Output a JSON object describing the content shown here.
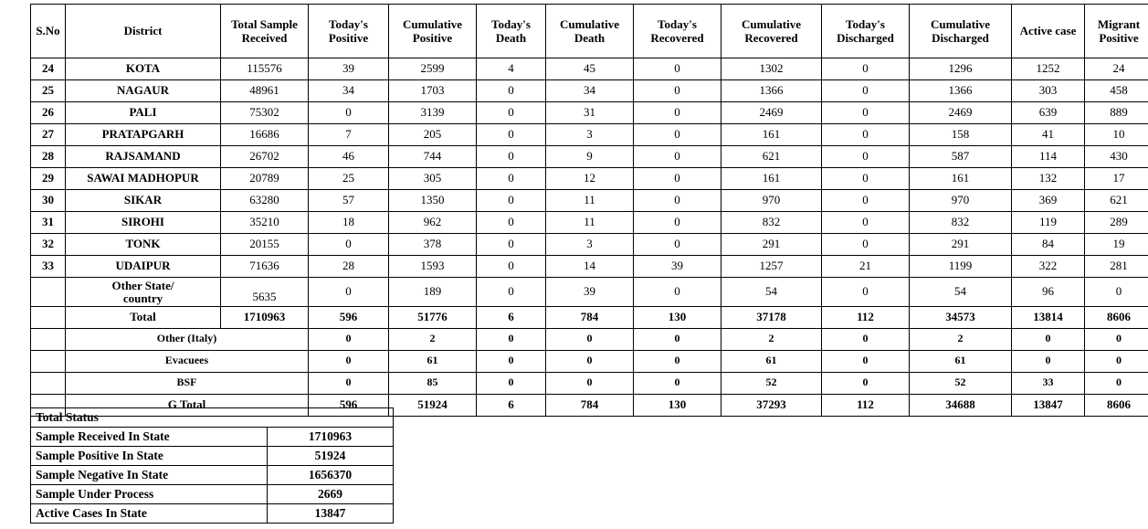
{
  "main_table": {
    "headers": [
      "S.No",
      "District",
      "Total Sample Received",
      "Today's Positive",
      "Cumulative Positive",
      "Today's Death",
      "Cumulative Death",
      "Today's Recovered",
      "Cumulative Recovered",
      "Today's Discharged",
      "Cumulative Discharged",
      "Active case",
      "Migrant Positive"
    ],
    "headers_lines": [
      [
        "S.No"
      ],
      [
        "District"
      ],
      [
        "Total Sample",
        "Received"
      ],
      [
        "Today's",
        "Positive"
      ],
      [
        "Cumulative",
        "Positive"
      ],
      [
        "Today's",
        "Death"
      ],
      [
        "Cumulative",
        "Death"
      ],
      [
        "Today's",
        "Recovered"
      ],
      [
        "Cumulative",
        "Recovered"
      ],
      [
        "Today's",
        "Discharged"
      ],
      [
        "Cumulative",
        "Discharged"
      ],
      [
        "Active  case"
      ],
      [
        "Migrant",
        "Positive"
      ]
    ],
    "rows": [
      {
        "sno": "24",
        "district": "KOTA",
        "total_sample_received": "115576",
        "todays_positive": "39",
        "cumulative_positive": "2599",
        "todays_death": "4",
        "cumulative_death": "45",
        "todays_recovered": "0",
        "cumulative_recovered": "1302",
        "todays_discharged": "0",
        "cumulative_discharged": "1296",
        "active_case": "1252",
        "migrant_positive": "24"
      },
      {
        "sno": "25",
        "district": "NAGAUR",
        "total_sample_received": "48961",
        "todays_positive": "34",
        "cumulative_positive": "1703",
        "todays_death": "0",
        "cumulative_death": "34",
        "todays_recovered": "0",
        "cumulative_recovered": "1366",
        "todays_discharged": "0",
        "cumulative_discharged": "1366",
        "active_case": "303",
        "migrant_positive": "458"
      },
      {
        "sno": "26",
        "district": "PALI",
        "total_sample_received": "75302",
        "todays_positive": "0",
        "cumulative_positive": "3139",
        "todays_death": "0",
        "cumulative_death": "31",
        "todays_recovered": "0",
        "cumulative_recovered": "2469",
        "todays_discharged": "0",
        "cumulative_discharged": "2469",
        "active_case": "639",
        "migrant_positive": "889"
      },
      {
        "sno": "27",
        "district": "PRATAPGARH",
        "total_sample_received": "16686",
        "todays_positive": "7",
        "cumulative_positive": "205",
        "todays_death": "0",
        "cumulative_death": "3",
        "todays_recovered": "0",
        "cumulative_recovered": "161",
        "todays_discharged": "0",
        "cumulative_discharged": "158",
        "active_case": "41",
        "migrant_positive": "10"
      },
      {
        "sno": "28",
        "district": "RAJSAMAND",
        "total_sample_received": "26702",
        "todays_positive": "46",
        "cumulative_positive": "744",
        "todays_death": "0",
        "cumulative_death": "9",
        "todays_recovered": "0",
        "cumulative_recovered": "621",
        "todays_discharged": "0",
        "cumulative_discharged": "587",
        "active_case": "114",
        "migrant_positive": "430"
      },
      {
        "sno": "29",
        "district": "SAWAI MADHOPUR",
        "total_sample_received": "20789",
        "todays_positive": "25",
        "cumulative_positive": "305",
        "todays_death": "0",
        "cumulative_death": "12",
        "todays_recovered": "0",
        "cumulative_recovered": "161",
        "todays_discharged": "0",
        "cumulative_discharged": "161",
        "active_case": "132",
        "migrant_positive": "17"
      },
      {
        "sno": "30",
        "district": "SIKAR",
        "total_sample_received": "63280",
        "todays_positive": "57",
        "cumulative_positive": "1350",
        "todays_death": "0",
        "cumulative_death": "11",
        "todays_recovered": "0",
        "cumulative_recovered": "970",
        "todays_discharged": "0",
        "cumulative_discharged": "970",
        "active_case": "369",
        "migrant_positive": "621"
      },
      {
        "sno": "31",
        "district": "SIROHI",
        "total_sample_received": "35210",
        "todays_positive": "18",
        "cumulative_positive": "962",
        "todays_death": "0",
        "cumulative_death": "11",
        "todays_recovered": "0",
        "cumulative_recovered": "832",
        "todays_discharged": "0",
        "cumulative_discharged": "832",
        "active_case": "119",
        "migrant_positive": "289"
      },
      {
        "sno": "32",
        "district": "TONK",
        "total_sample_received": "20155",
        "todays_positive": "0",
        "cumulative_positive": "378",
        "todays_death": "0",
        "cumulative_death": "3",
        "todays_recovered": "0",
        "cumulative_recovered": "291",
        "todays_discharged": "0",
        "cumulative_discharged": "291",
        "active_case": "84",
        "migrant_positive": "19"
      },
      {
        "sno": "33",
        "district": "UDAIPUR",
        "total_sample_received": "71636",
        "todays_positive": "28",
        "cumulative_positive": "1593",
        "todays_death": "0",
        "cumulative_death": "14",
        "todays_recovered": "39",
        "cumulative_recovered": "1257",
        "todays_discharged": "21",
        "cumulative_discharged": "1199",
        "active_case": "322",
        "migrant_positive": "281"
      }
    ],
    "other_state_row": {
      "sno": "",
      "district_line1": "Other State/",
      "district_line2": "country",
      "total_sample_received": "5635",
      "todays_positive": "0",
      "cumulative_positive": "189",
      "todays_death": "0",
      "cumulative_death": "39",
      "todays_recovered": "0",
      "cumulative_recovered": "54",
      "todays_discharged": "0",
      "cumulative_discharged": "54",
      "active_case": "96",
      "migrant_positive": "0"
    },
    "total_row": {
      "label": "Total",
      "total_sample_received": "1710963",
      "todays_positive": "596",
      "cumulative_positive": "51776",
      "todays_death": "6",
      "cumulative_death": "784",
      "todays_recovered": "130",
      "cumulative_recovered": "37178",
      "todays_discharged": "112",
      "cumulative_discharged": "34573",
      "active_case": "13814",
      "migrant_positive": "8606"
    },
    "sub_rows": [
      {
        "label": "Other (Italy)",
        "todays_positive": "0",
        "cumulative_positive": "2",
        "todays_death": "0",
        "cumulative_death": "0",
        "todays_recovered": "0",
        "cumulative_recovered": "2",
        "todays_discharged": "0",
        "cumulative_discharged": "2",
        "active_case": "0",
        "migrant_positive": "0"
      },
      {
        "label": "Evacuees",
        "todays_positive": "0",
        "cumulative_positive": "61",
        "todays_death": "0",
        "cumulative_death": "0",
        "todays_recovered": "0",
        "cumulative_recovered": "61",
        "todays_discharged": "0",
        "cumulative_discharged": "61",
        "active_case": "0",
        "migrant_positive": "0"
      },
      {
        "label": "BSF",
        "todays_positive": "0",
        "cumulative_positive": "85",
        "todays_death": "0",
        "cumulative_death": "0",
        "todays_recovered": "0",
        "cumulative_recovered": "52",
        "todays_discharged": "0",
        "cumulative_discharged": "52",
        "active_case": "33",
        "migrant_positive": "0"
      }
    ],
    "grand_total_row": {
      "label": "G Total",
      "todays_positive": "596",
      "cumulative_positive": "51924",
      "todays_death": "6",
      "cumulative_death": "784",
      "todays_recovered": "130",
      "cumulative_recovered": "37293",
      "todays_discharged": "112",
      "cumulative_discharged": "34688",
      "active_case": "13847",
      "migrant_positive": "8606"
    }
  },
  "summary_table": {
    "title": "Total Status",
    "rows": [
      {
        "label": "Sample Received In State",
        "value": "1710963"
      },
      {
        "label": "Sample Positive In State",
        "value": "51924"
      },
      {
        "label": "Sample Negative In State",
        "value": "1656370"
      },
      {
        "label": "Sample Under Process",
        "value": "2669"
      },
      {
        "label": "Active Cases In State",
        "value": "13847"
      }
    ]
  }
}
